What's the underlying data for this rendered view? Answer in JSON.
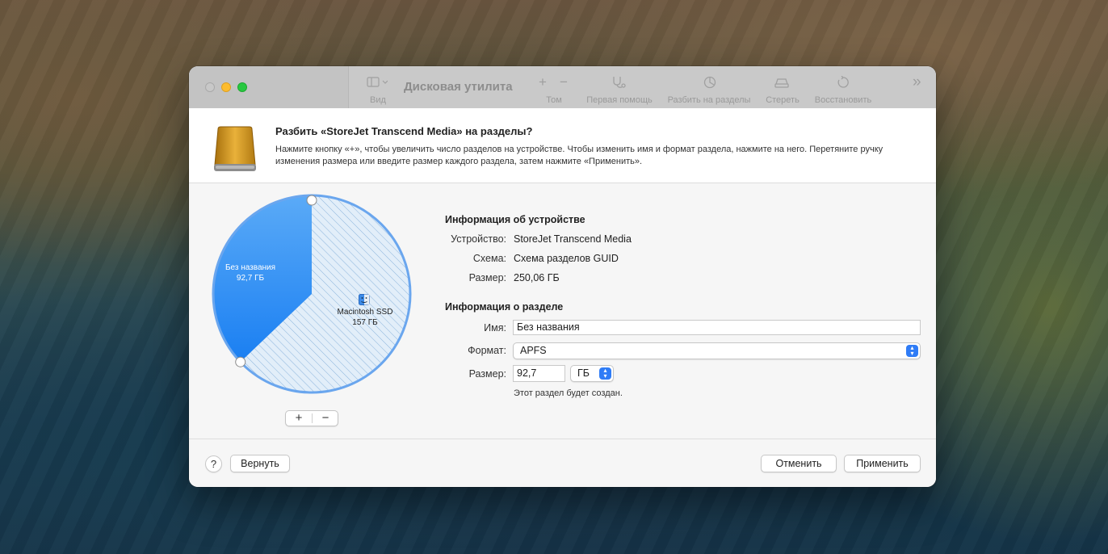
{
  "app": {
    "title": "Дисковая утилита",
    "toolbar": {
      "view_label": "Вид",
      "volume_label": "Том",
      "first_aid_label": "Первая помощь",
      "partition_label": "Разбить на разделы",
      "erase_label": "Стереть",
      "restore_label": "Восстановить",
      "add_symbol": "+",
      "remove_symbol": "−",
      "more_symbol": "»"
    }
  },
  "sheet": {
    "title": "Разбить «StoreJet Transcend Media» на разделы?",
    "description": "Нажмите кнопку «+», чтобы увеличить число разделов на устройстве. Чтобы изменить имя и формат раздела, нажмите на него. Перетяните ручку изменения размера или введите размер каждого раздела, затем нажмите «Применить»."
  },
  "pie": {
    "partitions": [
      {
        "name": "Без названия",
        "size": "92,7 ГБ",
        "size_gb": 92.7,
        "color": "#2b8cf5",
        "selected": true
      },
      {
        "name": "Macintosh SSD",
        "size": "157 ГБ",
        "size_gb": 157,
        "color": "#dcebf8",
        "hatched": true
      }
    ],
    "add_label": "+",
    "remove_label": "−"
  },
  "device_info": {
    "heading": "Информация об устройстве",
    "device_label": "Устройство:",
    "device_value": "StoreJet Transcend Media",
    "scheme_label": "Схема:",
    "scheme_value": "Схема разделов GUID",
    "size_label": "Размер:",
    "size_value": "250,06 ГБ"
  },
  "partition_info": {
    "heading": "Информация о разделе",
    "name_label": "Имя:",
    "name_value": "Без названия",
    "format_label": "Формат:",
    "format_value": "APFS",
    "size_label": "Размер:",
    "size_value": "92,7",
    "unit_value": "ГБ",
    "note": "Этот раздел будет создан."
  },
  "buttons": {
    "help": "?",
    "revert": "Вернуть",
    "cancel": "Отменить",
    "apply": "Применить"
  },
  "colors": {
    "accent": "#2f7cf6",
    "selected_partition": "#2b8cf5",
    "pie_outline": "#6aa6ee"
  }
}
